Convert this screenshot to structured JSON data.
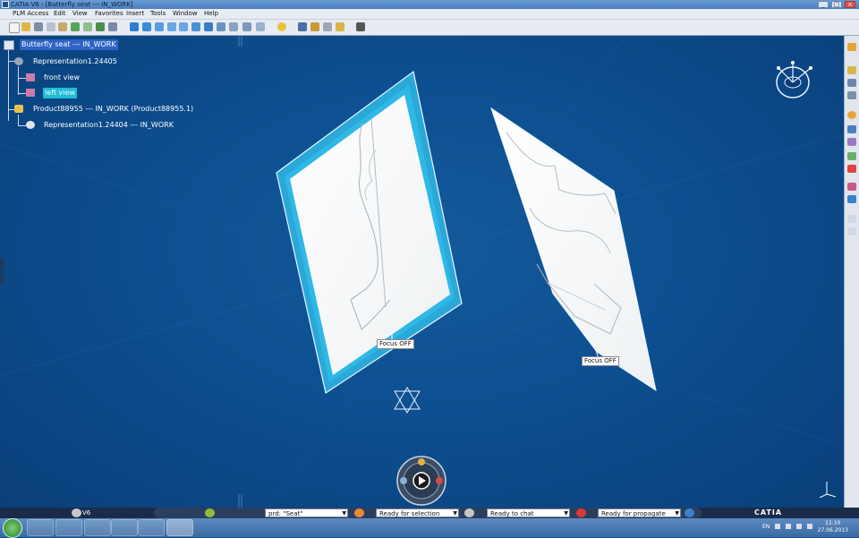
{
  "window": {
    "title": "CATIA V6 - [Butterfly seat --- IN_WORK]"
  },
  "menu": [
    "PLM Access",
    "Edit",
    "View",
    "Favorites",
    "Insert",
    "Tools",
    "Window",
    "Help"
  ],
  "tree": {
    "root": "Butterfly seat --- IN_WORK",
    "representation": "Representation1.24405",
    "front_view": "front view",
    "left_view": "left view",
    "product": "Product88955 --- IN_WORK (Product88955.1)",
    "representation2": "Representation1.24404 --- IN_WORK"
  },
  "viewport": {
    "focus_left": "Focus OFF",
    "focus_right": "Focus OFF"
  },
  "statusbar": {
    "v6_label": "V6",
    "search_value": "prd: \"Seat\"",
    "selection": "Ready for selection",
    "chat": "Ready to chat",
    "propagate": "Ready for propagate",
    "brand": "CATIA"
  },
  "taskbar": {
    "lang": "EN",
    "time": "11:10",
    "date": "27.06.2013"
  },
  "colors": {
    "viewport_bg": "#0c4d8a",
    "selection": "#2f63c6",
    "highlight": "#20bcd4"
  }
}
